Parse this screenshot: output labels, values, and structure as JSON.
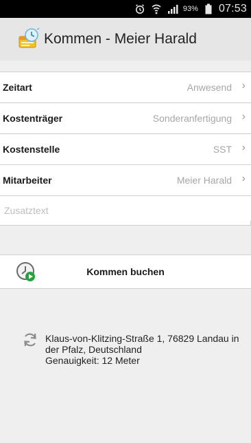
{
  "status_bar": {
    "battery": "93%",
    "time": "07:53",
    "icons": [
      "alarm-icon",
      "wifi-icon",
      "signal-icon",
      "battery-icon"
    ]
  },
  "app_bar": {
    "title": "Kommen - Meier Harald",
    "logo_icon": "clock-calendar-logo-icon"
  },
  "form": {
    "rows": [
      {
        "label": "Zeitart",
        "value": "Anwesend"
      },
      {
        "label": "Kostenträger",
        "value": "Sonderanfertigung"
      },
      {
        "label": "Kostenstelle",
        "value": "SST"
      },
      {
        "label": "Mitarbeiter",
        "value": "Meier Harald"
      }
    ],
    "zusatztext_placeholder": "Zusatztext",
    "chevron": "›"
  },
  "action": {
    "label": "Kommen buchen",
    "icon": "clock-play-icon"
  },
  "location": {
    "line1": "Klaus-von-Klitzing-Straße 1, 76829 Landau in",
    "line2": "der Pfalz, Deutschland",
    "line3": "Genauigkeit: 12 Meter",
    "icon": "refresh-icon"
  },
  "colors": {
    "statusbar_bg": "#000000",
    "appbar_bg": "#e6e6e6",
    "content_bg": "#efefef",
    "value_text": "#a6a6a6"
  }
}
